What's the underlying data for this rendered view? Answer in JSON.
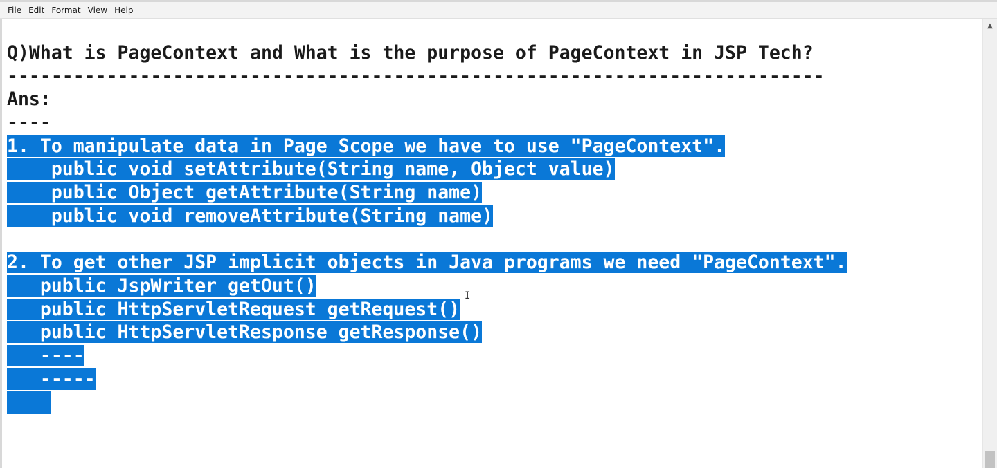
{
  "menu": {
    "items": [
      "File",
      "Edit",
      "Format",
      "View",
      "Help"
    ]
  },
  "editor": {
    "selection_color": "#0a78d7",
    "lines": [
      {
        "text": "Q)What is PageContext and What is the purpose of PageContext in JSP Tech?",
        "selected": false
      },
      {
        "text": "--------------------------------------------------------------------------",
        "selected": false
      },
      {
        "text": "Ans:",
        "selected": false
      },
      {
        "text": "----",
        "selected": false
      },
      {
        "text": "1. To manipulate data in Page Scope we have to use \"PageContext\".",
        "selected": true
      },
      {
        "text": "    public void setAttribute(String name, Object value)",
        "selected": true
      },
      {
        "text": "    public Object getAttribute(String name)",
        "selected": true
      },
      {
        "text": "    public void removeAttribute(String name)",
        "selected": true
      },
      {
        "text": "",
        "selected": false
      },
      {
        "text": "2. To get other JSP implicit objects in Java programs we need \"PageContext\".",
        "selected": true
      },
      {
        "text": "   public JspWriter getOut()",
        "selected": true
      },
      {
        "text": "   public HttpServletRequest getRequest()",
        "selected": true
      },
      {
        "text": "   public HttpServletResponse getResponse()",
        "selected": true
      },
      {
        "text": "   ----",
        "selected": true
      },
      {
        "text": "   -----",
        "selected": true
      },
      {
        "text": "",
        "selected": true,
        "caret_block": true
      }
    ]
  },
  "icons": {
    "scroll_up": "scroll-up-arrow-icon",
    "cursor": "i-beam-cursor-icon"
  }
}
